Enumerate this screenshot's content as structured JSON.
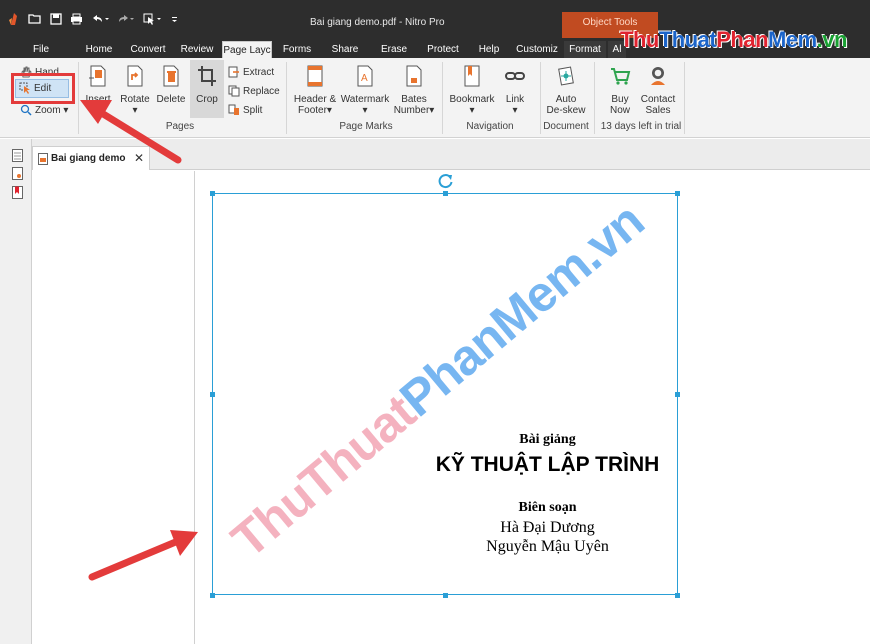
{
  "window": {
    "title": "Bai giang demo.pdf - Nitro Pro",
    "context_group": "Object Tools"
  },
  "brand": {
    "part1": "Thu",
    "part2": "Thuat",
    "part3": "Phan",
    "part4": "Mem",
    "part5": ".vn"
  },
  "tabs": [
    {
      "label": "File"
    },
    {
      "label": "Home"
    },
    {
      "label": "Convert"
    },
    {
      "label": "Review"
    },
    {
      "label": "Page Layc",
      "active": true
    },
    {
      "label": "Forms"
    },
    {
      "label": "Share"
    },
    {
      "label": "Erase"
    },
    {
      "label": "Protect"
    },
    {
      "label": "Help"
    },
    {
      "label": "Customiz"
    },
    {
      "label": "Format"
    },
    {
      "label": "Al"
    }
  ],
  "ribbon": {
    "tools": {
      "hand": "Hand",
      "edit": "Edit",
      "zoom": "Zoom ▾"
    },
    "pages": {
      "insert": "Insert",
      "rotate": "Rotate",
      "delete": "Delete",
      "crop": "Crop",
      "extract": "Extract",
      "replace": "Replace",
      "split": "Split",
      "group": "Pages"
    },
    "page_marks": {
      "header_line1": "Header &",
      "header_line2": "Footer▾",
      "watermark": "Watermark",
      "watermark_sub": "▾",
      "bates_line1": "Bates",
      "bates_line2": "Number▾",
      "group": "Page Marks"
    },
    "navigation": {
      "bookmark": "Bookmark",
      "bookmark_sub": "▾",
      "link": "Link",
      "link_sub": "▾",
      "group": "Navigation"
    },
    "document": {
      "line1": "Auto",
      "line2": "De-skew",
      "group": "Document"
    },
    "trial": {
      "buy1": "Buy",
      "buy2": "Now",
      "contact1": "Contact",
      "contact2": "Sales",
      "group": "13 days left in trial"
    }
  },
  "doc_tab": {
    "label": "Bai giang demo",
    "close": "✕"
  },
  "page": {
    "subtitle": "Bài giảng",
    "title": "KỸ THUẬT LẬP TRÌNH",
    "role": "Biên soạn",
    "author1": "Hà Đại Dương",
    "author2": "Nguyễn Mậu Uyên"
  },
  "watermark": {
    "part1": "ThuThuat",
    "part2": "PhanMem",
    "part3": ".vn"
  },
  "icons": {
    "rotate_handle": "rotate-icon",
    "close": "close-icon"
  },
  "colors": {
    "accent": "#2a9fd6",
    "annotation": "#e33b3b",
    "context_tab": "#c14b21",
    "brand_blue": "#1b64c9",
    "brand_red": "#e0232f",
    "brand_green": "#19a032"
  }
}
